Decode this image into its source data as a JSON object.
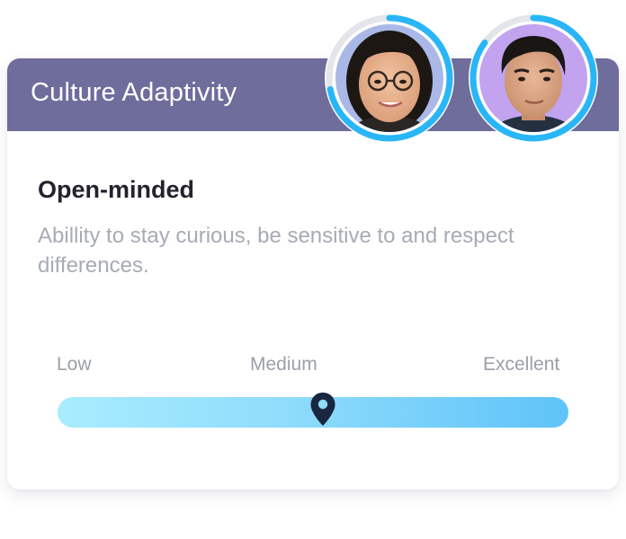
{
  "card": {
    "title": "Culture Adaptivity"
  },
  "trait": {
    "title": "Open-minded",
    "description": "Abillity to stay curious, be sensitive to and respect differences."
  },
  "scale": {
    "labels": [
      "Low",
      "Medium",
      "Excellent"
    ],
    "value_fraction": 0.52
  },
  "avatars": [
    {
      "name": "avatar-woman",
      "progress_fraction": 0.72
    },
    {
      "name": "avatar-man",
      "progress_fraction": 0.85
    }
  ],
  "colors": {
    "header_bg": "#6e6d9c",
    "progress_ring": "#29b6f6",
    "ring_track": "#e3e5ea",
    "slider_start": "#a9ecfe",
    "slider_end": "#5fc3f8",
    "handle": "#1a2740"
  }
}
